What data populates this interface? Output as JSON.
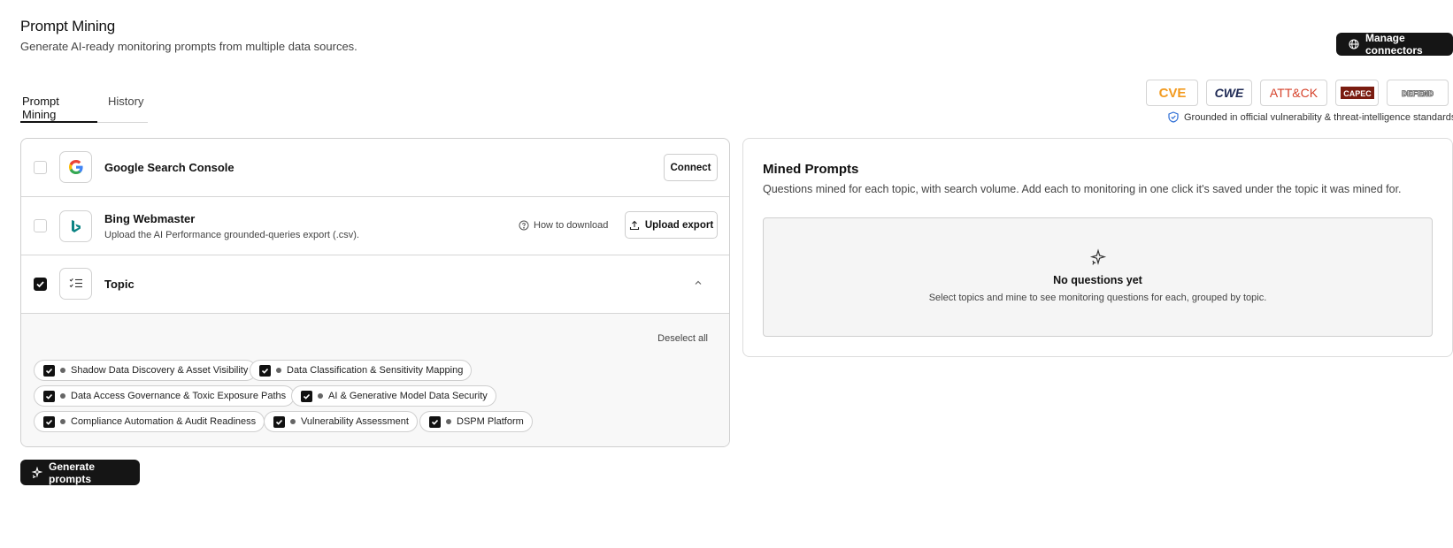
{
  "header": {
    "title": "Prompt Mining",
    "subtitle": "Generate AI-ready monitoring prompts from multiple data sources.",
    "manage_label": "Manage connectors"
  },
  "tabs": [
    {
      "label": "Prompt Mining",
      "active": true
    },
    {
      "label": "History",
      "active": false
    }
  ],
  "standards": {
    "logos": [
      "CVE",
      "CWE",
      "ATT&CK",
      "CAPEC",
      "DEFEND"
    ],
    "note": "Grounded in official vulnerability & threat-intelligence standards."
  },
  "sources": {
    "google": {
      "title": "Google Search Console",
      "checked": false,
      "button": "Connect"
    },
    "bing": {
      "title": "Bing Webmaster",
      "sub": "Upload the AI Performance grounded-queries export (.csv).",
      "checked": false,
      "how_label": "How to download",
      "upload_label": "Upload export"
    },
    "topic": {
      "title": "Topic",
      "checked": true,
      "expanded": true
    }
  },
  "topics": {
    "deselect_label": "Deselect all",
    "items": [
      "Shadow Data Discovery & Asset Visibility",
      "Data Classification & Sensitivity Mapping",
      "Data Access Governance & Toxic Exposure Paths",
      "AI & Generative Model Data Security",
      "Compliance Automation & Audit Readiness",
      "Vulnerability Assessment",
      "DSPM Platform"
    ]
  },
  "generate_label": "Generate prompts",
  "mined": {
    "title": "Mined Prompts",
    "sub": "Questions mined for each topic, with search volume. Add each to monitoring in one click it's saved under the topic it was mined for.",
    "empty_title": "No questions yet",
    "empty_sub": "Select topics and mine to see monitoring questions for each, grouped by topic."
  },
  "colors": {
    "dark": "#151515",
    "cve": "#f29a1f",
    "attck": "#d6422b",
    "capec": "#7a1c10"
  }
}
